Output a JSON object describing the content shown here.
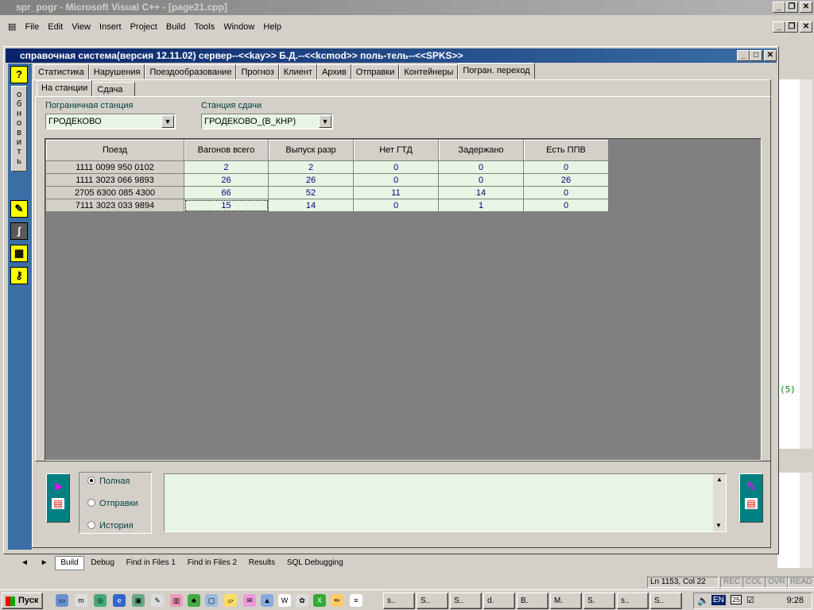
{
  "ide": {
    "title": "spr_pogr - Microsoft Visual C++ - [page21.cpp]",
    "menu": [
      "File",
      "Edit",
      "View",
      "Insert",
      "Project",
      "Build",
      "Tools",
      "Window",
      "Help"
    ],
    "code_fragment": "(5)",
    "output_tabs": [
      "Build",
      "Debug",
      "Find in Files 1",
      "Find in Files 2",
      "Results",
      "SQL Debugging"
    ],
    "status": {
      "position": "Ln 1153, Col 22",
      "rec": "REC",
      "col": "COL",
      "ovr": "OVR",
      "read": "READ"
    }
  },
  "app": {
    "title": "справочная система(версия 12.11.02) сервер--<<kay>> Б.Д.--<<kcmod>> поль-тель--<<SPKS>>",
    "left_toolbar": {
      "help_label": "?",
      "refresh_label": "о\nб\nн\nо\nв\nи\nт\nь"
    },
    "main_tabs": [
      "Статистика",
      "Нарушения",
      "Поездообразование",
      "Прогноз",
      "Клиент",
      "Архив",
      "Отправки",
      "Контейнеры",
      "Погран. переход"
    ],
    "active_main_tab": "Погран. переход",
    "sub_tabs": [
      "На станции",
      "Сдача"
    ],
    "active_sub_tab": "На станции",
    "border_station": {
      "label": "Пограничная станция",
      "value": "ГРОДЕКОВО"
    },
    "handover_station": {
      "label": "Станция сдачи",
      "value": "ГРОДЕКОВО_(В_КНР)"
    },
    "grid": {
      "columns": [
        "Поезд",
        "Вагонов всего",
        "Выпуск разр",
        "Нет ГТД",
        "Задержано",
        "Есть ППВ"
      ],
      "rows": [
        [
          "1111 0099 950 0102",
          "2",
          "2",
          "0",
          "0",
          "0"
        ],
        [
          "1111 3023 066 9893",
          "26",
          "26",
          "0",
          "0",
          "26"
        ],
        [
          "2705 6300 085 4300",
          "66",
          "52",
          "11",
          "14",
          "0"
        ],
        [
          "7111 3023 033 9894",
          "15",
          "14",
          "0",
          "1",
          "0"
        ]
      ]
    },
    "mode_options": [
      "Полная",
      "Отправки",
      "История"
    ],
    "selected_mode": "Полная",
    "memo_text": ""
  },
  "taskbar": {
    "start_label": "Пуск",
    "tasks": [
      "s..",
      "S..",
      "S..",
      "d.",
      "B.",
      "M.",
      "S.",
      "s..",
      "S..",
      "C.."
    ],
    "active_task": "C..",
    "lang": "EN",
    "date_badge": "25",
    "time": "9:28"
  }
}
